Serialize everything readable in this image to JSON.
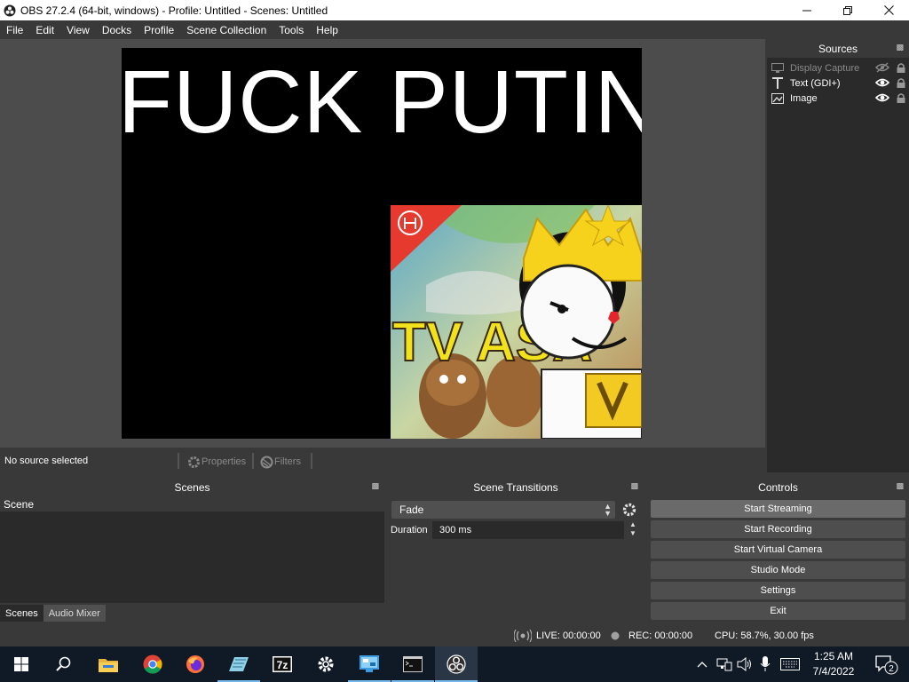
{
  "window": {
    "title": "OBS 27.2.4 (64-bit, windows) - Profile: Untitled - Scenes: Untitled"
  },
  "menu": [
    "File",
    "Edit",
    "View",
    "Docks",
    "Profile",
    "Scene Collection",
    "Tools",
    "Help"
  ],
  "preview": {
    "overlay_text": "FUCK PUTIN",
    "image_text": "TV ASA"
  },
  "sources": {
    "title": "Sources",
    "items": [
      {
        "name": "Display Capture",
        "visible": false,
        "icon": "monitor-icon"
      },
      {
        "name": "Text (GDI+)",
        "visible": true,
        "icon": "text-icon"
      },
      {
        "name": "Image",
        "visible": true,
        "icon": "image-icon"
      }
    ]
  },
  "source_bar": {
    "status": "No source selected",
    "properties_label": "Properties",
    "filters_label": "Filters"
  },
  "scenes": {
    "title": "Scenes",
    "items": [
      "Scene"
    ],
    "tabs": [
      "Scenes",
      "Audio Mixer"
    ]
  },
  "transitions": {
    "title": "Scene Transitions",
    "selected": "Fade",
    "duration_label": "Duration",
    "duration_value": "300 ms"
  },
  "controls": {
    "title": "Controls",
    "buttons": [
      "Start Streaming",
      "Start Recording",
      "Start Virtual Camera",
      "Studio Mode",
      "Settings",
      "Exit"
    ]
  },
  "statusbar": {
    "live": "LIVE: 00:00:00",
    "rec": "REC: 00:00:00",
    "cpu": "CPU: 58.7%, 30.00 fps"
  },
  "taskbar": {
    "time": "1:25 AM",
    "date": "7/4/2022",
    "notification_count": "2",
    "apps": [
      "start-icon",
      "search-icon",
      "file-explorer-icon",
      "chrome-icon",
      "firefox-icon",
      "notepad-icon",
      "7zip-icon",
      "settings-icon",
      "control-panel-icon",
      "terminal-icon",
      "obs-icon"
    ],
    "seven_zip_label": "7z"
  },
  "colors": {
    "background": "#3a393a",
    "dock_background": "#2b2a2b",
    "preview_background": "#4c4c4c",
    "taskbar": "#101a26",
    "accent": "#76b9ed"
  }
}
